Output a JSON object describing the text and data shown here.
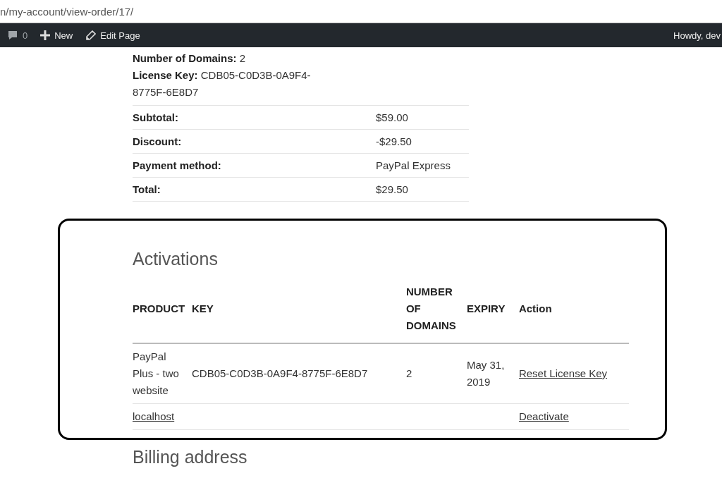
{
  "address_bar": {
    "url": "n/my-account/view-order/17/"
  },
  "admin_bar": {
    "comments_count": "0",
    "new_label": "New",
    "edit_label": "Edit Page",
    "greeting": "Howdy, dev"
  },
  "item_meta": [
    {
      "label": "Number of Domains:",
      "value": "2"
    },
    {
      "label": "License Key:",
      "value": "CDB05-C0D3B-0A9F4-8775F-6E8D7"
    }
  ],
  "totals": [
    {
      "label": "Subtotal:",
      "value": "$59.00"
    },
    {
      "label": "Discount:",
      "value": "-$29.50"
    },
    {
      "label": "Payment method:",
      "value": "PayPal Express"
    },
    {
      "label": "Total:",
      "value": "$29.50"
    }
  ],
  "activations": {
    "title": "Activations",
    "columns": [
      "PRODUCT",
      "KEY",
      "NUMBER OF DOMAINS",
      "EXPIRY",
      "Action"
    ],
    "rows": [
      {
        "kind": "license",
        "product": "PayPal Plus - two website",
        "key": "CDB05-C0D3B-0A9F4-8775F-6E8D7",
        "domains": "2",
        "expiry": "May 31, 2019",
        "action": "Reset License Key"
      },
      {
        "kind": "domain",
        "product": "localhost",
        "action": "Deactivate"
      }
    ]
  },
  "billing_title": "Billing address"
}
